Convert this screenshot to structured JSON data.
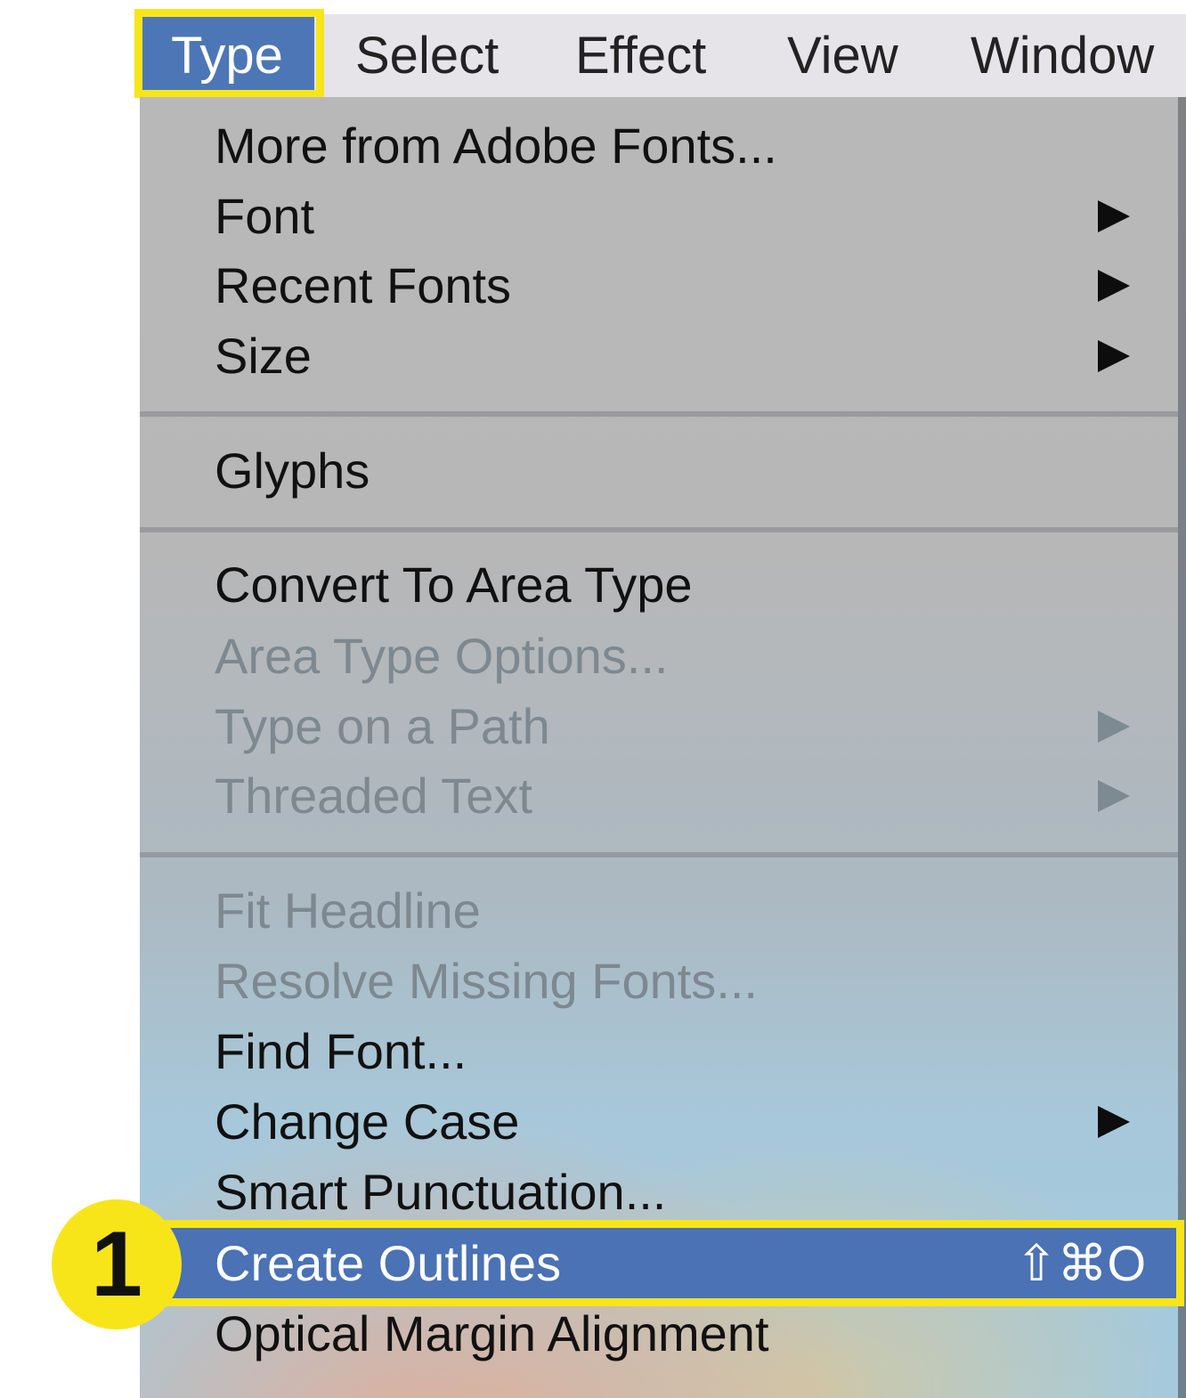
{
  "menubar": {
    "items": [
      {
        "label": "Type"
      },
      {
        "label": "Select"
      },
      {
        "label": "Effect"
      },
      {
        "label": "View"
      },
      {
        "label": "Window"
      }
    ]
  },
  "menu": {
    "items": [
      {
        "label": "More from Adobe Fonts..."
      },
      {
        "label": "Font"
      },
      {
        "label": "Recent Fonts"
      },
      {
        "label": "Size"
      },
      {
        "label": "Glyphs"
      },
      {
        "label": "Convert To Area Type"
      },
      {
        "label": "Area Type Options..."
      },
      {
        "label": "Type on a Path"
      },
      {
        "label": "Threaded Text"
      },
      {
        "label": "Fit Headline"
      },
      {
        "label": "Resolve Missing Fonts..."
      },
      {
        "label": "Find Font..."
      },
      {
        "label": "Change Case"
      },
      {
        "label": "Smart Punctuation..."
      },
      {
        "label": "Create Outlines",
        "shortcut": "⇧⌘O"
      },
      {
        "label": "Optical Margin Alignment"
      }
    ]
  },
  "annotation": {
    "step_number": "1",
    "highlight_color": "#f7e51a"
  },
  "colors": {
    "selection": "#4a72b4",
    "menubar_bg": "#e6e3e9"
  }
}
